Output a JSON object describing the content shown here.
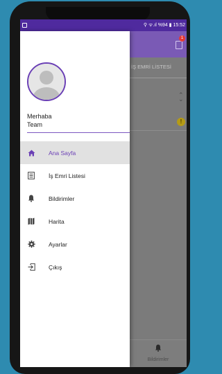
{
  "status_bar": {
    "right_text": "⚲ ᯤ.ıl %94 ▮ 15:52"
  },
  "app_bar": {
    "badge_count": "1"
  },
  "tab_header": {
    "label": "İŞ EMRİ LİSTESİ"
  },
  "background_card": {
    "warning_symbol": "!"
  },
  "bottom_nav": {
    "label": "Bildirimler"
  },
  "drawer": {
    "greeting_line1": "Merhaba",
    "greeting_line2": "Team",
    "items": [
      {
        "label": "Ana Sayfa",
        "icon": "home-icon",
        "active": true
      },
      {
        "label": "İş Emri Listesi",
        "icon": "list-icon",
        "active": false
      },
      {
        "label": "Bildirimler",
        "icon": "bell-icon",
        "active": false
      },
      {
        "label": "Harita",
        "icon": "map-icon",
        "active": false
      },
      {
        "label": "Ayarlar",
        "icon": "gear-icon",
        "active": false
      },
      {
        "label": "Çıkış",
        "icon": "exit-icon",
        "active": false
      }
    ]
  },
  "colors": {
    "accent": "#6a3fb5",
    "status_bar": "#4f2a9e",
    "background": "#2e8bb0"
  }
}
